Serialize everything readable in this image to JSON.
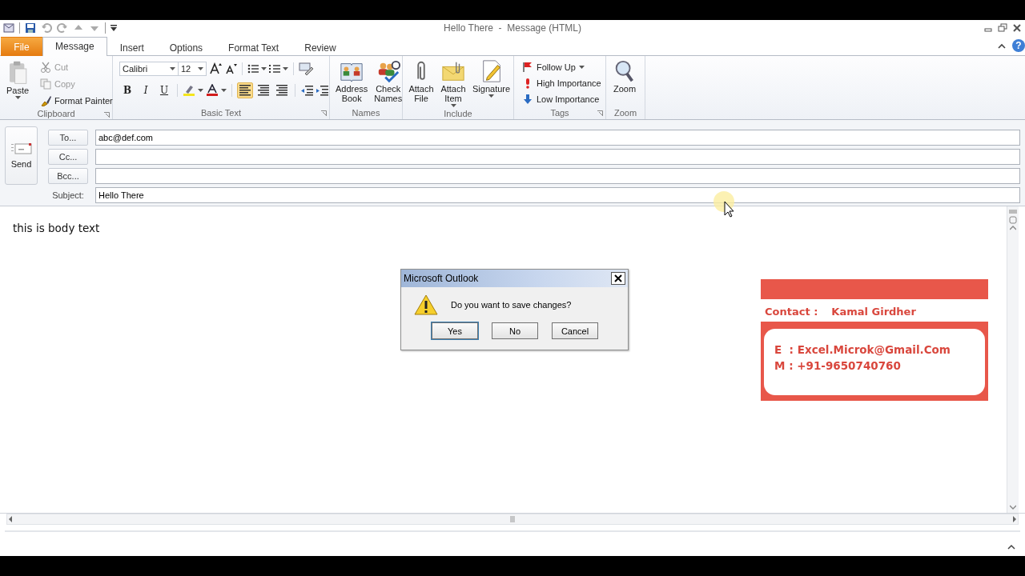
{
  "window": {
    "title": "Hello There  -  Message (HTML)"
  },
  "tabs": [
    {
      "label": "File",
      "kind": "file",
      "selected": false
    },
    {
      "label": "Message",
      "kind": "tab",
      "selected": true
    },
    {
      "label": "Insert",
      "kind": "tab",
      "selected": false
    },
    {
      "label": "Options",
      "kind": "tab",
      "selected": false
    },
    {
      "label": "Format Text",
      "kind": "tab",
      "selected": false
    },
    {
      "label": "Review",
      "kind": "tab",
      "selected": false
    }
  ],
  "help": "?",
  "ribbon": {
    "clipboard": {
      "label": "Clipboard",
      "paste": "Paste",
      "items": [
        {
          "label": "Cut",
          "disabled": true
        },
        {
          "label": "Copy",
          "disabled": true
        },
        {
          "label": "Format Painter",
          "disabled": false
        }
      ]
    },
    "basic_text": {
      "label": "Basic Text",
      "font": "Calibri",
      "size": "12",
      "format_buttons": [
        "B",
        "I",
        "U"
      ],
      "align": [
        {
          "selected": true
        },
        {
          "selected": false
        },
        {
          "selected": false
        }
      ]
    },
    "names": {
      "label": "Names",
      "items": [
        {
          "label": "Address Book",
          "dropdown": false
        },
        {
          "label": "Check Names",
          "dropdown": false
        }
      ]
    },
    "include": {
      "label": "Include",
      "items": [
        {
          "label": "Attach File",
          "dropdown": false
        },
        {
          "label": "Attach Item",
          "dropdown": true
        },
        {
          "label": "Signature",
          "dropdown": true
        }
      ]
    },
    "tags": {
      "label": "Tags",
      "items": [
        {
          "label": "Follow Up",
          "dropdown": true
        },
        {
          "label": "High Importance",
          "dropdown": false
        },
        {
          "label": "Low Importance",
          "dropdown": false
        }
      ]
    },
    "zoom": {
      "label": "Zoom",
      "items": [
        {
          "label": "Zoom",
          "dropdown": false
        }
      ]
    }
  },
  "compose": {
    "send": "Send",
    "recipients": [
      {
        "label": "To...",
        "value": "abc@def.com"
      },
      {
        "label": "Cc..."
      },
      {
        "label": "Bcc..."
      }
    ],
    "subject": {
      "label": "Subject:",
      "value": "Hello There"
    }
  },
  "body": {
    "text": "this is body text",
    "contact_card": {
      "label": "Contact :",
      "name": "Kamal Girdher",
      "lines": [
        "E  : Excel.Microk@Gmail.Com",
        "M : +91-9650740760"
      ]
    }
  },
  "dialog": {
    "title": "Microsoft Outlook",
    "message": "Do you want to save changes?",
    "buttons": [
      "Yes",
      "No",
      "Cancel"
    ]
  }
}
